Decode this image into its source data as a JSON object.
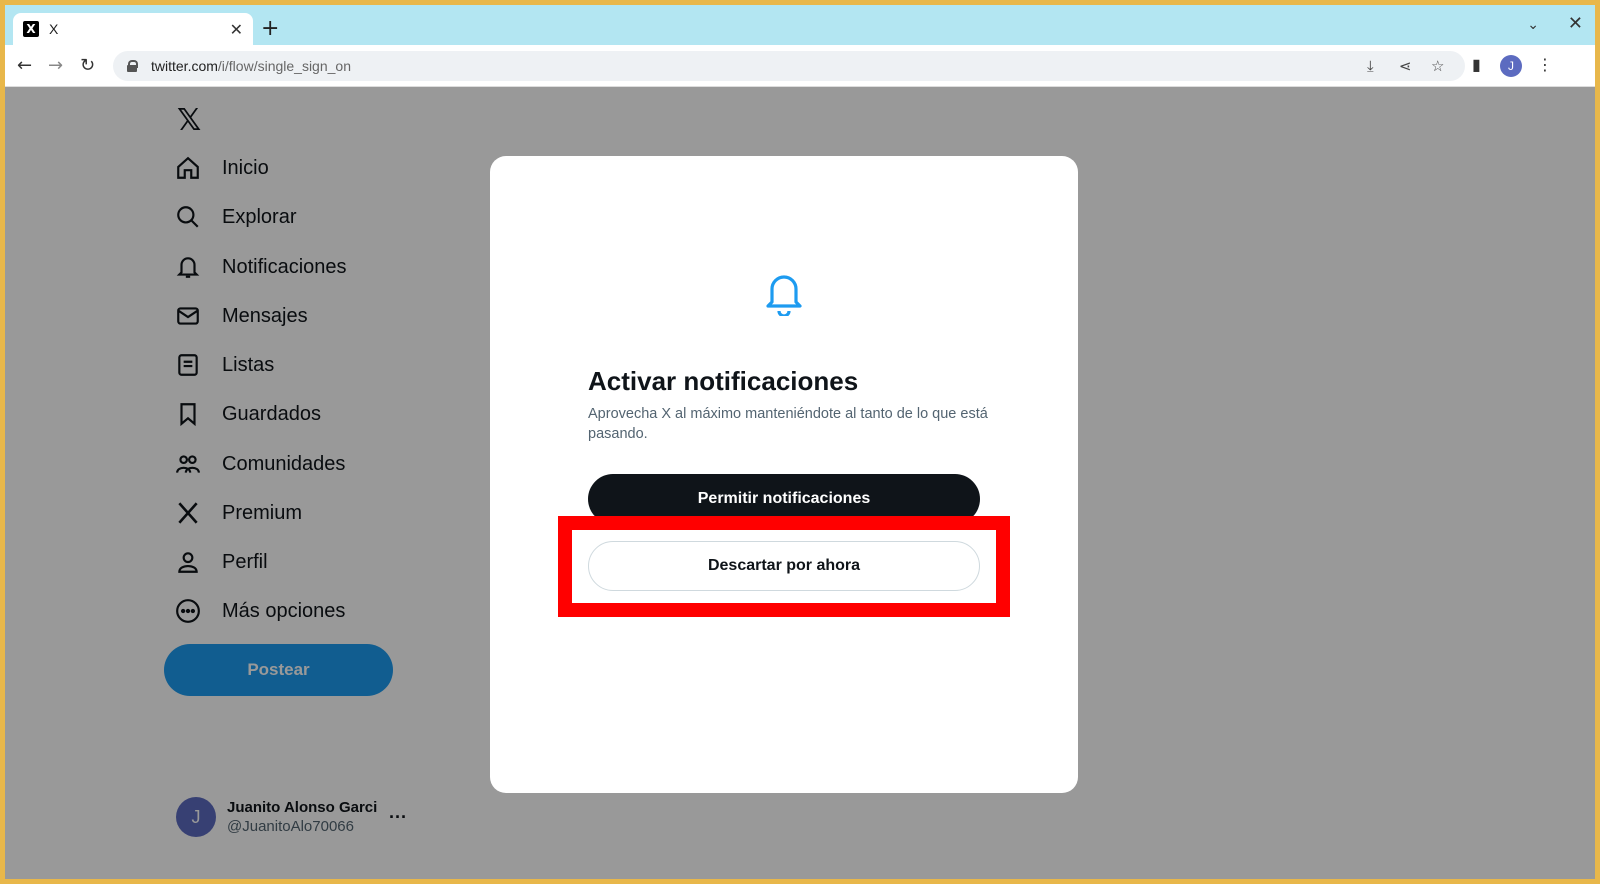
{
  "browser": {
    "tab_favicon": "X",
    "tab_title": "X",
    "tab_close": "✕",
    "new_tab": "+",
    "tab_list": "⌄",
    "window_close": "✕",
    "url_domain": "twitter.com",
    "url_path": "/i/flow/single_sign_on",
    "profile_initial": "J"
  },
  "sidebar": {
    "logo": "𝕏",
    "items": [
      {
        "label": "Inicio",
        "icon": "home-icon"
      },
      {
        "label": "Explorar",
        "icon": "search-icon"
      },
      {
        "label": "Notificaciones",
        "icon": "bell-icon"
      },
      {
        "label": "Mensajes",
        "icon": "mail-icon"
      },
      {
        "label": "Listas",
        "icon": "list-icon"
      },
      {
        "label": "Guardados",
        "icon": "bookmark-icon"
      },
      {
        "label": "Comunidades",
        "icon": "communities-icon"
      },
      {
        "label": "Premium",
        "icon": "x-icon"
      },
      {
        "label": "Perfil",
        "icon": "person-icon"
      },
      {
        "label": "Más opciones",
        "icon": "more-circle-icon"
      }
    ],
    "post_label": "Postear"
  },
  "account": {
    "initial": "J",
    "name": "Juanito Alonso Garcia",
    "handle": "@JuanitoAlo70066",
    "more": "···"
  },
  "modal": {
    "title": "Activar notificaciones",
    "description": "Aprovecha X al máximo manteniéndote al tanto de lo que está pasando.",
    "allow_label": "Permitir notificaciones",
    "dismiss_label": "Descartar por ahora"
  },
  "colors": {
    "brand_blue": "#1d9bf0",
    "dark": "#0f1419",
    "highlight": "#ff0000"
  }
}
